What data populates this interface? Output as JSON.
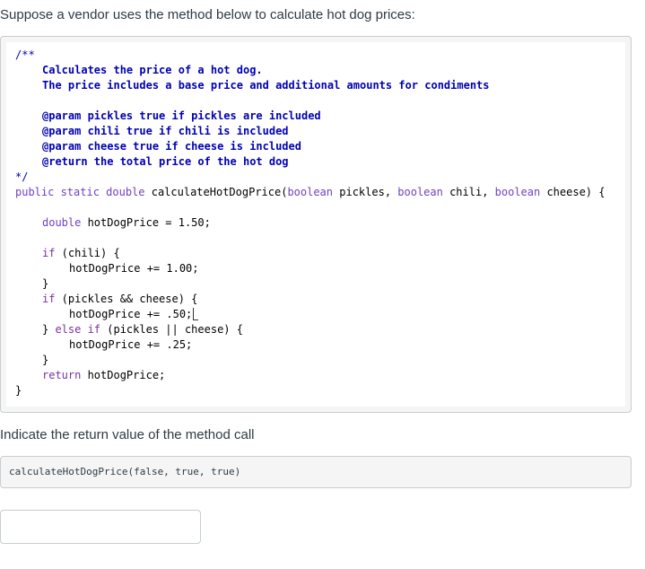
{
  "prompt": "Suppose a vendor uses the method below to calculate hot dog prices:",
  "code": {
    "comment_open": "/**",
    "doc_line1": "Calculates the price of a hot dog.",
    "doc_line2": "The price includes a base price and additional amounts for condiments",
    "param_pickles": "@param pickles true if pickles are included",
    "param_chili": "@param chili true if chili is included",
    "param_cheese": "@param cheese true if cheese is included",
    "return_doc": "@return the total price of the hot dog",
    "comment_close": "*/",
    "sig_mod": "public static double ",
    "sig_name": "calculateHotDogPrice(",
    "sig_t1": "boolean",
    "sig_p1": " pickles, ",
    "sig_t2": "boolean",
    "sig_p2": " chili, ",
    "sig_t3": "boolean",
    "sig_p3": " cheese) {",
    "decl_type": "double",
    "decl_rest": " hotDogPrice = 1.50;",
    "if1_kw": "if",
    "if1_rest": " (chili) {",
    "if1_body": "hotDogPrice += 1.00;",
    "close1": "}",
    "if2_kw": "if",
    "if2_rest": " (pickles && cheese) {",
    "if2_body": "hotDogPrice += .50;",
    "else_open": "} ",
    "else_kw": "else if",
    "else_rest": " (pickles || cheese) {",
    "else_body": "hotDogPrice += .25;",
    "close2": "}",
    "return_kw": "return",
    "return_rest": " hotDogPrice;",
    "close_method": "}"
  },
  "question": "Indicate the return value of the method call",
  "method_call": "calculateHotDogPrice(false, true, true)",
  "answer": {
    "value": "",
    "placeholder": ""
  }
}
